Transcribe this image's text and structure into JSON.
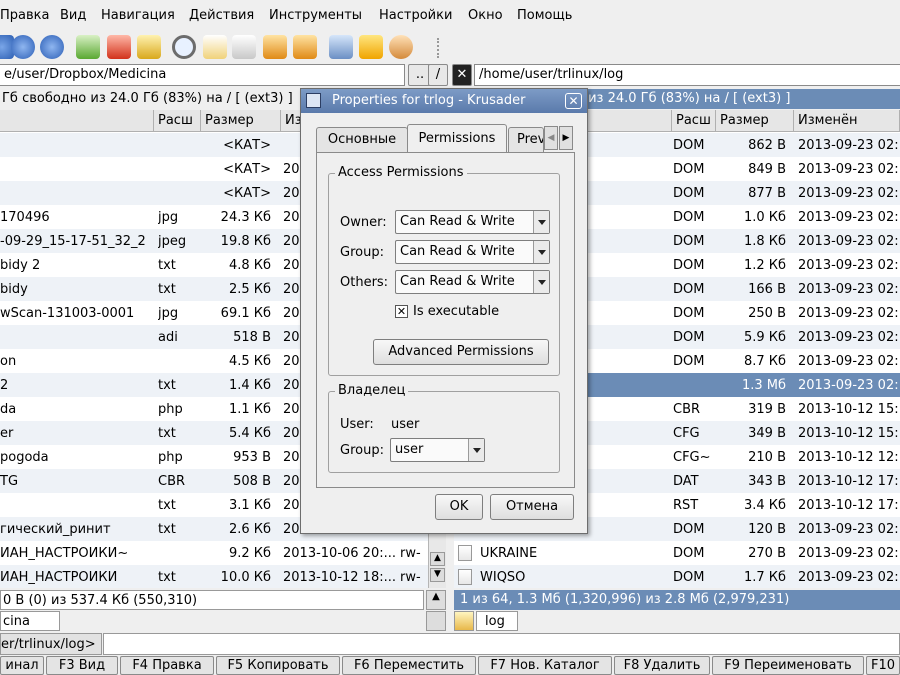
{
  "menu": [
    "Правка",
    "Вид",
    "Навигация",
    "Действия",
    "Инструменты",
    "Настройки",
    "Окно",
    "Помощь"
  ],
  "toolbar_icons": [
    "home-icon",
    "refresh-icon",
    "check-green-icon",
    "delete-red-icon",
    "check-yellow-icon",
    "search-icon",
    "new-file-icon",
    "copy-icon",
    "compare-icon",
    "move-icon",
    "network-icon",
    "lightning-icon",
    "user-icon"
  ],
  "left": {
    "path": "e/user/Dropbox/Medicina",
    "status": "Гб свободно из 24.0 Гб (83%) на / [ (ext3) ]",
    "headers": [
      "Расш",
      "Размер",
      "Из"
    ],
    "rows": [
      {
        "name": "",
        "ext": "",
        "size": "<КАТ>",
        "date": ""
      },
      {
        "name": "",
        "ext": "",
        "size": "<КАТ>",
        "date": "20"
      },
      {
        "name": "",
        "ext": "",
        "size": "<КАТ>",
        "date": "20"
      },
      {
        "name": "170496",
        "ext": "jpg",
        "size": "24.3 Кб",
        "date": "20"
      },
      {
        "name": "-09-29_15-17-51_32_2",
        "ext": "jpeg",
        "size": "19.8 Кб",
        "date": "20"
      },
      {
        "name": "bidy 2",
        "ext": "txt",
        "size": "4.8 Кб",
        "date": "20"
      },
      {
        "name": "bidy",
        "ext": "txt",
        "size": "2.5 Кб",
        "date": "20"
      },
      {
        "name": "wScan-131003-0001",
        "ext": "jpg",
        "size": "69.1 Кб",
        "date": "20"
      },
      {
        "name": "",
        "ext": "adi",
        "size": "518 B",
        "date": "20"
      },
      {
        "name": "on",
        "ext": "",
        "size": "4.5 Кб",
        "date": "20"
      },
      {
        "name": "2",
        "ext": "txt",
        "size": "1.4 Кб",
        "date": "20"
      },
      {
        "name": "da",
        "ext": "php",
        "size": "1.1 Кб",
        "date": "20"
      },
      {
        "name": "er",
        "ext": "txt",
        "size": "5.4 Кб",
        "date": "20"
      },
      {
        "name": "pogoda",
        "ext": "php",
        "size": "953 B",
        "date": "20"
      },
      {
        "name": "TG",
        "ext": "CBR",
        "size": "508 B",
        "date": "20"
      },
      {
        "name": "",
        "ext": "txt",
        "size": "3.1 Кб",
        "date": "20"
      },
      {
        "name": "гический_ринит",
        "ext": "txt",
        "size": "2.6 Кб",
        "date": "20"
      },
      {
        "name": "ИАН_НАСТРОЙКИ~",
        "ext": "",
        "size": "9.2 Кб",
        "date": "2013-10-06 20:...",
        "perm": "rw-"
      },
      {
        "name": "ИАН_НАСТРОЙКИ",
        "ext": "txt",
        "size": "10.0 Кб",
        "date": "2013-10-12 18:...",
        "perm": "rw-"
      }
    ],
    "bottom": "0 B (0) из 537.4 Кб (550,310)",
    "tab": "cina"
  },
  "right": {
    "path": "/home/user/trlinux/log",
    "status": "о из 24.0 Гб (83%) на / [ (ext3) ]",
    "headers": [
      "Расш",
      "Размер",
      "Изменён"
    ],
    "rows": [
      {
        "name": "",
        "ext": "DOM",
        "size": "862 B",
        "date": "2013-09-23 02:.."
      },
      {
        "name": "",
        "ext": "DOM",
        "size": "849 B",
        "date": "2013-09-23 02:.."
      },
      {
        "name": "",
        "ext": "DOM",
        "size": "877 B",
        "date": "2013-09-23 02:.."
      },
      {
        "name": "",
        "ext": "DOM",
        "size": "1.0 Кб",
        "date": "2013-09-23 02:.."
      },
      {
        "name": "",
        "ext": "DOM",
        "size": "1.8 Кб",
        "date": "2013-09-23 02:.."
      },
      {
        "name": "",
        "ext": "DOM",
        "size": "1.2 Кб",
        "date": "2013-09-23 02:.."
      },
      {
        "name": "",
        "ext": "DOM",
        "size": "166 B",
        "date": "2013-09-23 02:.."
      },
      {
        "name": "",
        "ext": "DOM",
        "size": "250 B",
        "date": "2013-09-23 02:.."
      },
      {
        "name": "",
        "ext": "DOM",
        "size": "5.9 Кб",
        "date": "2013-09-23 02:.."
      },
      {
        "name": "",
        "ext": "DOM",
        "size": "8.7 Кб",
        "date": "2013-09-23 02:.."
      },
      {
        "name": "",
        "ext": "",
        "size": "1.3 Мб",
        "date": "2013-09-23 02:..",
        "selected": true
      },
      {
        "name": "",
        "ext": "CBR",
        "size": "319 B",
        "date": "2013-10-12 15:.."
      },
      {
        "name": "",
        "ext": "CFG",
        "size": "349 B",
        "date": "2013-10-12 15:.."
      },
      {
        "name": "",
        "ext": "CFG~",
        "size": "210 B",
        "date": "2013-10-12 12:.."
      },
      {
        "name": "",
        "ext": "DAT",
        "size": "343 B",
        "date": "2013-10-12 17:.."
      },
      {
        "name": "",
        "ext": "RST",
        "size": "3.4 Кб",
        "date": "2013-10-12 17:.."
      },
      {
        "name": "",
        "ext": "DOM",
        "size": "120 B",
        "date": "2013-09-23 02:.."
      },
      {
        "name": "UKRAINE",
        "ext": "DOM",
        "size": "270 B",
        "date": "2013-09-23 02:.."
      },
      {
        "name": "WIQSO",
        "ext": "DOM",
        "size": "1.7 Кб",
        "date": "2013-09-23 02:.."
      }
    ],
    "bottom": "1 из 64, 1.3 Мб (1,320,996) из 2.8 Мб (2,979,231)",
    "tab": "log"
  },
  "cmdline": {
    "prompt": "er/trlinux/log>",
    "value": ""
  },
  "fkeys": [
    "инал",
    "F3 Вид",
    "F4 Правка",
    "F5 Копировать",
    "F6 Переместить",
    "F7 Нов. Каталог",
    "F8 Удалить",
    "F9 Переименовать",
    "F10"
  ],
  "dialog": {
    "title": "Properties for trlog - Krusader",
    "tabs": [
      "Основные",
      "Permissions",
      "Prev"
    ],
    "access_title": "Access Permissions",
    "owner_label": "Owner:",
    "group_label": "Group:",
    "others_label": "Others:",
    "owner_value": "Can Read & Write",
    "group_value": "Can Read & Write",
    "others_value": "Can Read & Write",
    "exec_label": "Is executable",
    "exec_checked": true,
    "advanced_label": "Advanced Permissions",
    "owner_group_title": "Владелец",
    "user_label": "User:",
    "user_value": "user",
    "group2_label": "Group:",
    "group2_value": "user",
    "ok_label": "OK",
    "cancel_label": "Отмена"
  }
}
